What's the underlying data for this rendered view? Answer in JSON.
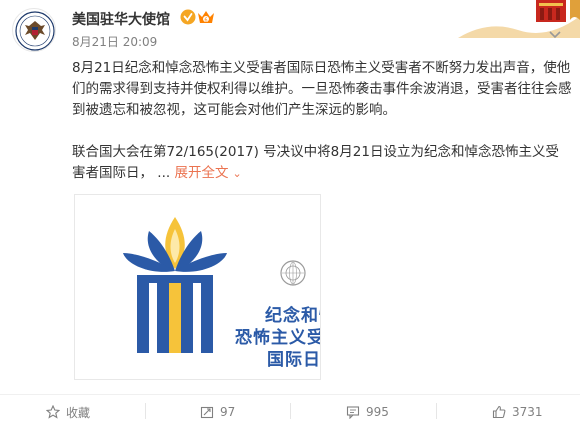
{
  "header": {
    "username": "美国驻华大使馆",
    "timestamp": "8月21日 20:09"
  },
  "post": {
    "paragraph1": "8月21日纪念和悼念恐怖主义受害者国际日恐怖主义受害者不断努力发出声音，使他们的需求得到支持并使权利得以维护。一旦恐怖袭击事件余波消退，受害者往往会感到被遗忘和被忽视，这可能会对他们产生深远的影响。",
    "paragraph2": "联合国大会在第72/165(2017) 号决议中将8月21日设立为纪念和悼念恐怖主义受害者国际日， ...",
    "expand_label": "展开全文"
  },
  "image": {
    "line1": "纪念和悼",
    "line2": "恐怖主义受",
    "line3": "国际日"
  },
  "actions": {
    "favorite_label": "收藏",
    "repost_count": "97",
    "comment_count": "995",
    "like_count": "3731"
  },
  "colors": {
    "link": "#eb7350",
    "logo_blue": "#2b5aa7",
    "logo_yellow": "#f6c33a",
    "verified_yellow": "#f5a623"
  }
}
